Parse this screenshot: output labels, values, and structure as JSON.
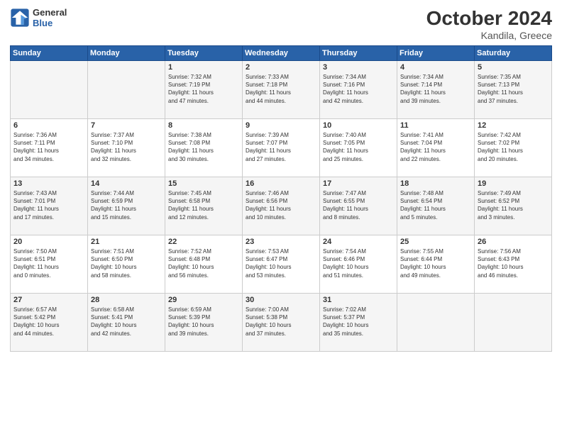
{
  "logo": {
    "line1": "General",
    "line2": "Blue"
  },
  "header": {
    "month": "October 2024",
    "location": "Kandila, Greece"
  },
  "weekdays": [
    "Sunday",
    "Monday",
    "Tuesday",
    "Wednesday",
    "Thursday",
    "Friday",
    "Saturday"
  ],
  "weeks": [
    [
      {
        "day": "",
        "lines": []
      },
      {
        "day": "",
        "lines": []
      },
      {
        "day": "1",
        "lines": [
          "Sunrise: 7:32 AM",
          "Sunset: 7:19 PM",
          "Daylight: 11 hours",
          "and 47 minutes."
        ]
      },
      {
        "day": "2",
        "lines": [
          "Sunrise: 7:33 AM",
          "Sunset: 7:18 PM",
          "Daylight: 11 hours",
          "and 44 minutes."
        ]
      },
      {
        "day": "3",
        "lines": [
          "Sunrise: 7:34 AM",
          "Sunset: 7:16 PM",
          "Daylight: 11 hours",
          "and 42 minutes."
        ]
      },
      {
        "day": "4",
        "lines": [
          "Sunrise: 7:34 AM",
          "Sunset: 7:14 PM",
          "Daylight: 11 hours",
          "and 39 minutes."
        ]
      },
      {
        "day": "5",
        "lines": [
          "Sunrise: 7:35 AM",
          "Sunset: 7:13 PM",
          "Daylight: 11 hours",
          "and 37 minutes."
        ]
      }
    ],
    [
      {
        "day": "6",
        "lines": [
          "Sunrise: 7:36 AM",
          "Sunset: 7:11 PM",
          "Daylight: 11 hours",
          "and 34 minutes."
        ]
      },
      {
        "day": "7",
        "lines": [
          "Sunrise: 7:37 AM",
          "Sunset: 7:10 PM",
          "Daylight: 11 hours",
          "and 32 minutes."
        ]
      },
      {
        "day": "8",
        "lines": [
          "Sunrise: 7:38 AM",
          "Sunset: 7:08 PM",
          "Daylight: 11 hours",
          "and 30 minutes."
        ]
      },
      {
        "day": "9",
        "lines": [
          "Sunrise: 7:39 AM",
          "Sunset: 7:07 PM",
          "Daylight: 11 hours",
          "and 27 minutes."
        ]
      },
      {
        "day": "10",
        "lines": [
          "Sunrise: 7:40 AM",
          "Sunset: 7:05 PM",
          "Daylight: 11 hours",
          "and 25 minutes."
        ]
      },
      {
        "day": "11",
        "lines": [
          "Sunrise: 7:41 AM",
          "Sunset: 7:04 PM",
          "Daylight: 11 hours",
          "and 22 minutes."
        ]
      },
      {
        "day": "12",
        "lines": [
          "Sunrise: 7:42 AM",
          "Sunset: 7:02 PM",
          "Daylight: 11 hours",
          "and 20 minutes."
        ]
      }
    ],
    [
      {
        "day": "13",
        "lines": [
          "Sunrise: 7:43 AM",
          "Sunset: 7:01 PM",
          "Daylight: 11 hours",
          "and 17 minutes."
        ]
      },
      {
        "day": "14",
        "lines": [
          "Sunrise: 7:44 AM",
          "Sunset: 6:59 PM",
          "Daylight: 11 hours",
          "and 15 minutes."
        ]
      },
      {
        "day": "15",
        "lines": [
          "Sunrise: 7:45 AM",
          "Sunset: 6:58 PM",
          "Daylight: 11 hours",
          "and 12 minutes."
        ]
      },
      {
        "day": "16",
        "lines": [
          "Sunrise: 7:46 AM",
          "Sunset: 6:56 PM",
          "Daylight: 11 hours",
          "and 10 minutes."
        ]
      },
      {
        "day": "17",
        "lines": [
          "Sunrise: 7:47 AM",
          "Sunset: 6:55 PM",
          "Daylight: 11 hours",
          "and 8 minutes."
        ]
      },
      {
        "day": "18",
        "lines": [
          "Sunrise: 7:48 AM",
          "Sunset: 6:54 PM",
          "Daylight: 11 hours",
          "and 5 minutes."
        ]
      },
      {
        "day": "19",
        "lines": [
          "Sunrise: 7:49 AM",
          "Sunset: 6:52 PM",
          "Daylight: 11 hours",
          "and 3 minutes."
        ]
      }
    ],
    [
      {
        "day": "20",
        "lines": [
          "Sunrise: 7:50 AM",
          "Sunset: 6:51 PM",
          "Daylight: 11 hours",
          "and 0 minutes."
        ]
      },
      {
        "day": "21",
        "lines": [
          "Sunrise: 7:51 AM",
          "Sunset: 6:50 PM",
          "Daylight: 10 hours",
          "and 58 minutes."
        ]
      },
      {
        "day": "22",
        "lines": [
          "Sunrise: 7:52 AM",
          "Sunset: 6:48 PM",
          "Daylight: 10 hours",
          "and 56 minutes."
        ]
      },
      {
        "day": "23",
        "lines": [
          "Sunrise: 7:53 AM",
          "Sunset: 6:47 PM",
          "Daylight: 10 hours",
          "and 53 minutes."
        ]
      },
      {
        "day": "24",
        "lines": [
          "Sunrise: 7:54 AM",
          "Sunset: 6:46 PM",
          "Daylight: 10 hours",
          "and 51 minutes."
        ]
      },
      {
        "day": "25",
        "lines": [
          "Sunrise: 7:55 AM",
          "Sunset: 6:44 PM",
          "Daylight: 10 hours",
          "and 49 minutes."
        ]
      },
      {
        "day": "26",
        "lines": [
          "Sunrise: 7:56 AM",
          "Sunset: 6:43 PM",
          "Daylight: 10 hours",
          "and 46 minutes."
        ]
      }
    ],
    [
      {
        "day": "27",
        "lines": [
          "Sunrise: 6:57 AM",
          "Sunset: 5:42 PM",
          "Daylight: 10 hours",
          "and 44 minutes."
        ]
      },
      {
        "day": "28",
        "lines": [
          "Sunrise: 6:58 AM",
          "Sunset: 5:41 PM",
          "Daylight: 10 hours",
          "and 42 minutes."
        ]
      },
      {
        "day": "29",
        "lines": [
          "Sunrise: 6:59 AM",
          "Sunset: 5:39 PM",
          "Daylight: 10 hours",
          "and 39 minutes."
        ]
      },
      {
        "day": "30",
        "lines": [
          "Sunrise: 7:00 AM",
          "Sunset: 5:38 PM",
          "Daylight: 10 hours",
          "and 37 minutes."
        ]
      },
      {
        "day": "31",
        "lines": [
          "Sunrise: 7:02 AM",
          "Sunset: 5:37 PM",
          "Daylight: 10 hours",
          "and 35 minutes."
        ]
      },
      {
        "day": "",
        "lines": []
      },
      {
        "day": "",
        "lines": []
      }
    ]
  ]
}
